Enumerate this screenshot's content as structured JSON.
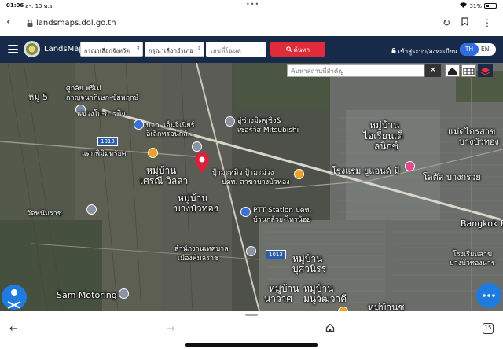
{
  "statusbar": {
    "time": "01:06",
    "date": "อา. 13 พ.ย.",
    "battery": "31%"
  },
  "browser": {
    "url": "landsmaps.dol.go.th"
  },
  "header": {
    "app_name": "LandsMaps",
    "province_select": "กรุณาเลือกจังหวัด",
    "district_select": "กรุณาเลือกอำเภอ",
    "parcel_placeholder": "เลขที่โฉนด",
    "search_label": "ค้นหา",
    "login_label": "เข้าสู่ระบบ/ลงทะเบียน",
    "lang_th": "TH",
    "lang_en": "EN"
  },
  "map": {
    "place_search_placeholder": "ค้นหาสถานที่สำคัญ",
    "close_label": "✕",
    "road_1": "1013",
    "road_2": "1013",
    "labels": [
      "หมู่ 5",
      "ศูกลัย พรีเม่",
      "กาญจนาภิเษก-ชัยพฤกษ์",
      "แขวงโก่-ภารกิจ",
      "บจก. เอ็นจิเนียร์",
      "อิเล็กทรอนิกส์...",
      "อู่ช่างมิตซูชิง&",
      "เซอร์วิส Mitsubishi",
      "แดกพิมิมทรัยศ",
      "หมู่บ้าน",
      "เศรณี วิลลา",
      "ปุ้ามะหมิว ปู้ามะม่วง",
      "ปตท. สาขาบางบัวทอง",
      "หมู่บ้าน",
      "บางบัวทอง",
      "วัดพนัมราช",
      "PTT Station ปตท.",
      "บ้านกล้วย-ไทรน้อย",
      "สำนักงานเทศบาล",
      "เมืองพิมลราช",
      "หมู่บ้าน",
      "บุศวนิรร",
      "Sam Motoring",
      "หมู่บ้าน",
      "นาวาศ",
      "หมู่บ้าน",
      "มนูวัฒวาคี",
      "หมู่บ้าน",
      "ไอเรียนเต็",
      "ลนิกซ์",
      "แม่ดไดรสาข",
      "บางบัวทอง",
      "โรงแรม ยูแอนด์ มี",
      "โลตัส บางกรวย",
      "Bangkok E",
      "โรงเรียนสาข",
      "บางบัวทองนาร",
      "หมู่บ้านช"
    ]
  },
  "toolbar": {
    "tab_count": "15"
  }
}
